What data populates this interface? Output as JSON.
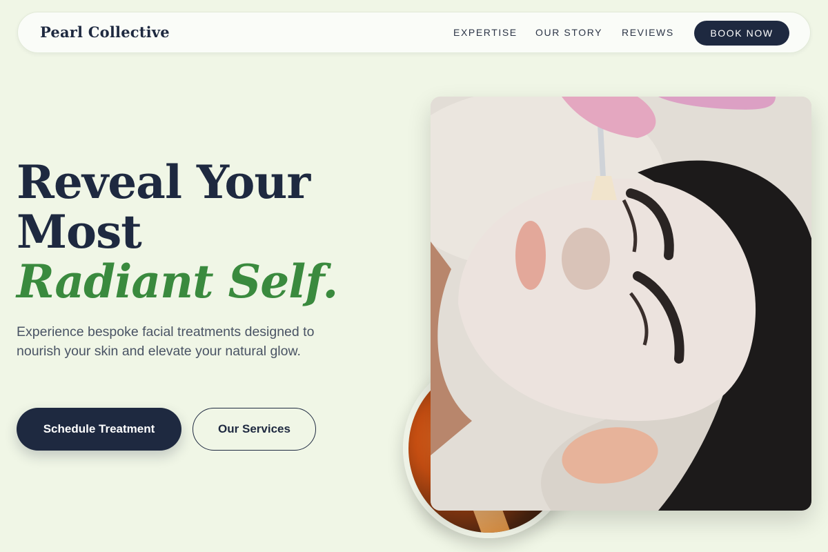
{
  "nav": {
    "brand": "Pearl Collective",
    "links": [
      "EXPERTISE",
      "OUR STORY",
      "REVIEWS"
    ],
    "cta": "BOOK NOW"
  },
  "hero": {
    "title_line1": "Reveal Your",
    "title_line2": "Most",
    "title_accent": "Radiant Self.",
    "subtitle": "Experience bespoke facial treatments designed to nourish your skin and elevate your natural glow.",
    "primary_button": "Schedule Treatment",
    "secondary_button": "Our Services"
  },
  "colors": {
    "background": "#f0f6e6",
    "navy": "#1e2940",
    "accent_green": "#3a8a3e"
  },
  "images": {
    "main_photo": "facial-treatment-photo",
    "circle_photo": "warm-candle-photo"
  }
}
